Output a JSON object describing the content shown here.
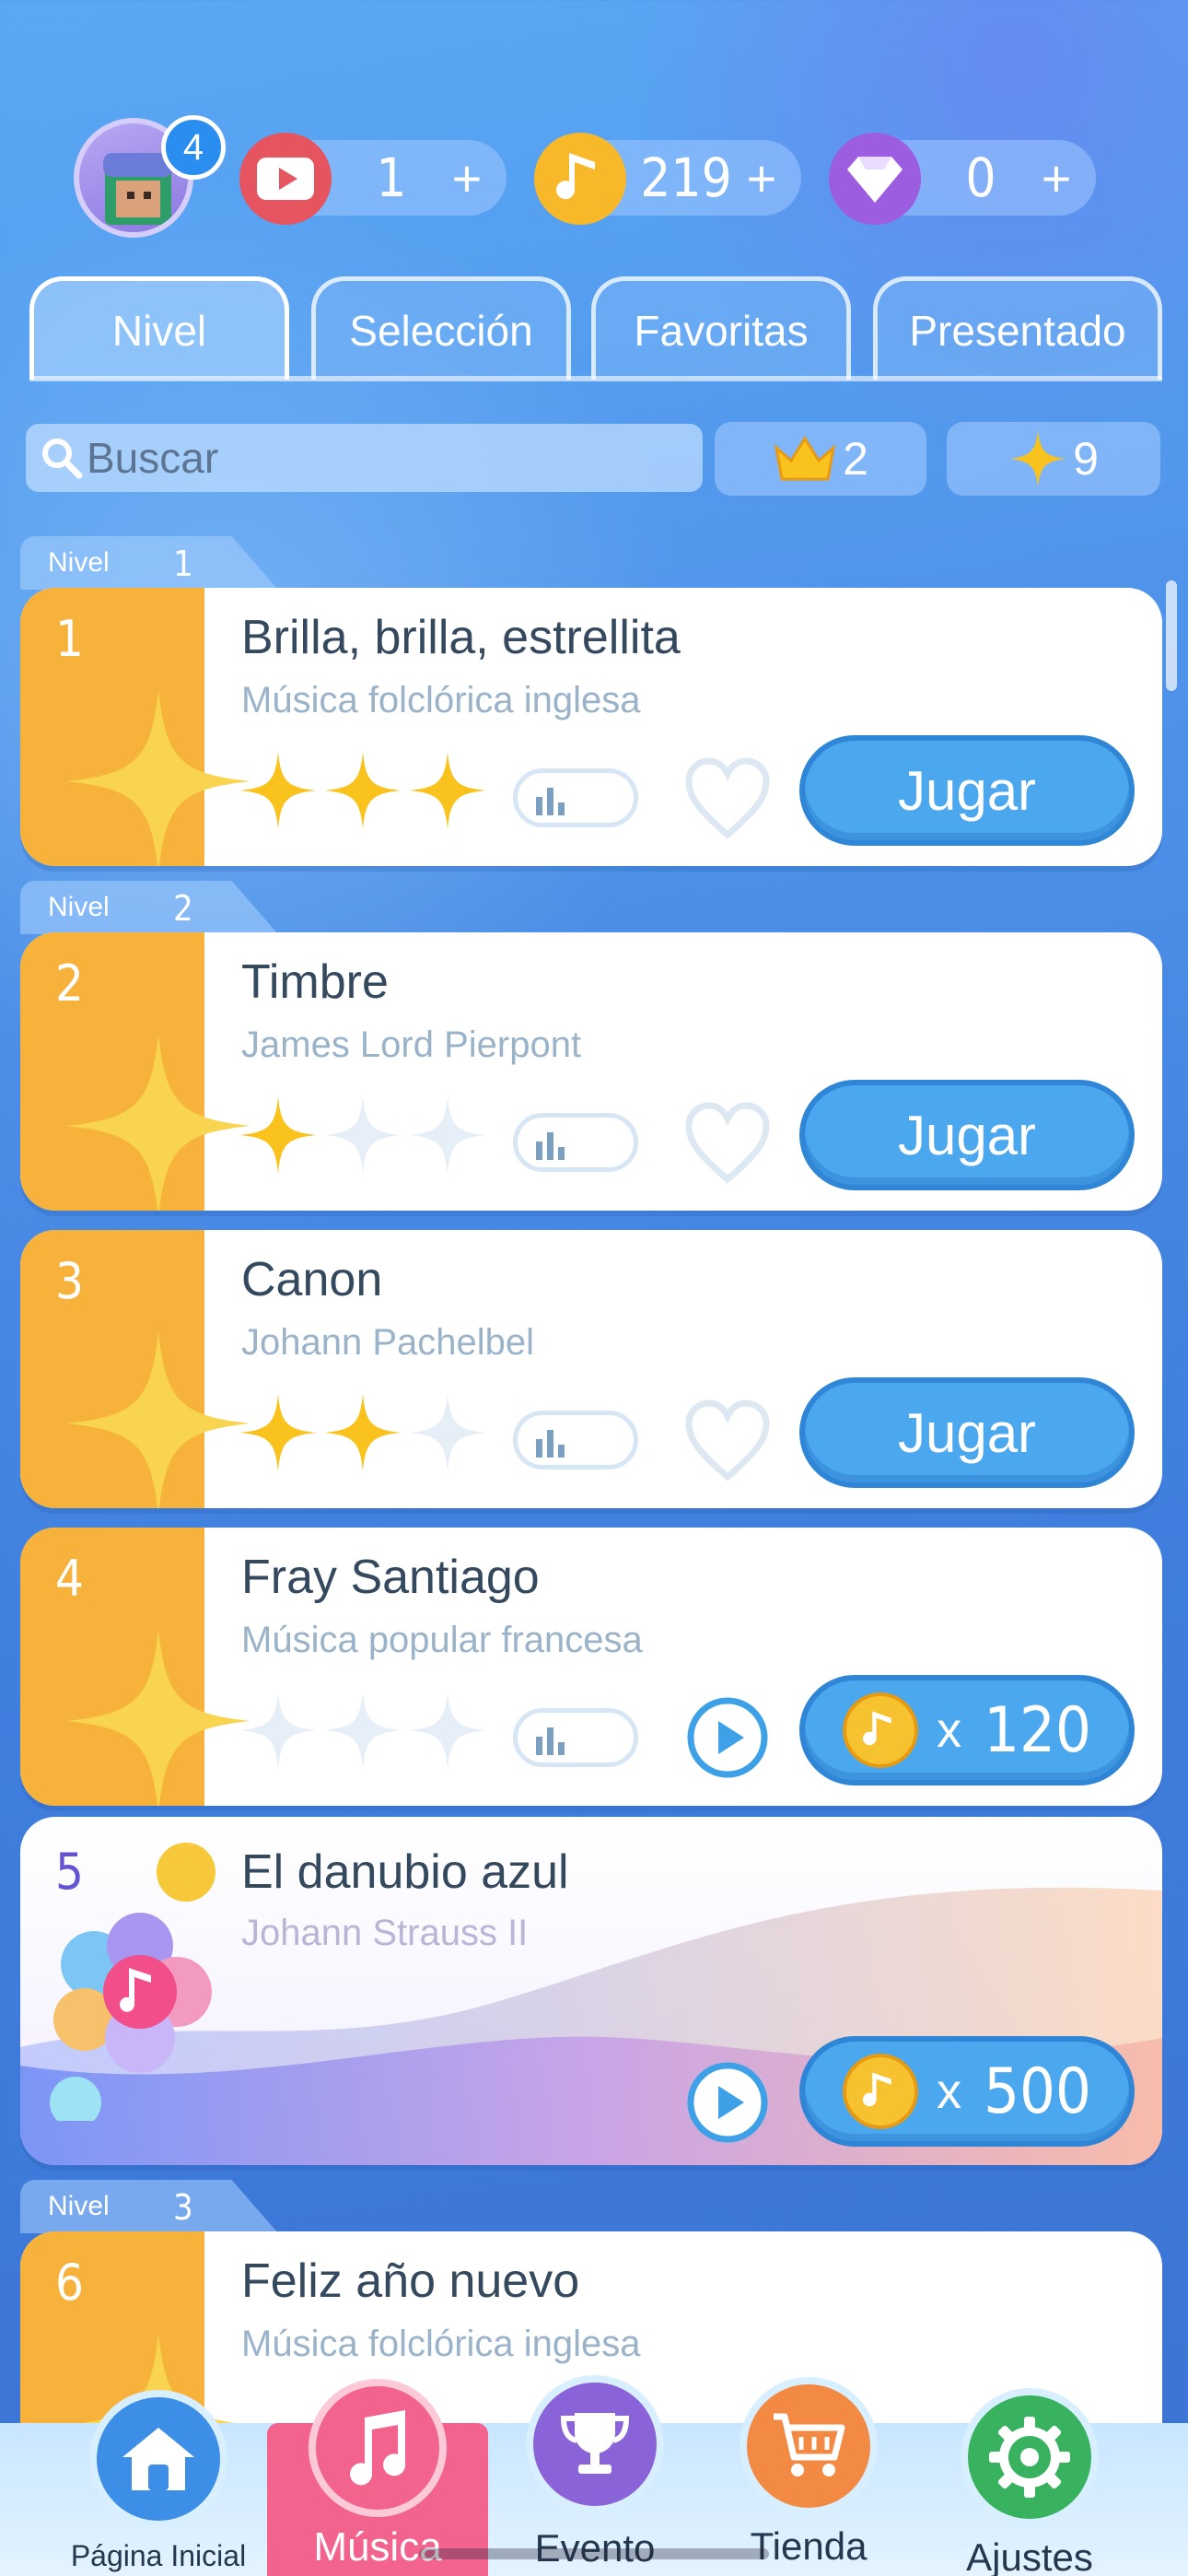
{
  "header": {
    "avatar_badge": "4",
    "currencies": [
      {
        "name": "tickets",
        "value": "1",
        "plus": "+"
      },
      {
        "name": "notes",
        "value": "219",
        "plus": "+"
      },
      {
        "name": "diamonds",
        "value": "0",
        "plus": "+"
      }
    ]
  },
  "tabs": [
    {
      "label": "Nivel",
      "active": true
    },
    {
      "label": "Selección",
      "active": false
    },
    {
      "label": "Favoritas",
      "active": false
    },
    {
      "label": "Presentado",
      "active": false
    }
  ],
  "search": {
    "placeholder": "Buscar"
  },
  "stats": {
    "crowns": "2",
    "stars": "9"
  },
  "levels": [
    {
      "label": "Nivel",
      "number": "1"
    },
    {
      "label": "Nivel",
      "number": "2"
    },
    {
      "label": "Nivel",
      "number": "3"
    }
  ],
  "songs": [
    {
      "num": "1",
      "title": "Brilla, brilla, estrellita",
      "artist": "Música folclórica inglesa",
      "stars": 3,
      "action": "Jugar"
    },
    {
      "num": "2",
      "title": "Timbre",
      "artist": "James Lord Pierpont",
      "stars": 1,
      "action": "Jugar"
    },
    {
      "num": "3",
      "title": "Canon",
      "artist": "Johann Pachelbel",
      "stars": 2,
      "action": "Jugar"
    },
    {
      "num": "4",
      "title": "Fray Santiago",
      "artist": "Música popular francesa",
      "stars": 0,
      "price_x": "x",
      "price": "120"
    },
    {
      "num": "5",
      "title": "El danubio azul",
      "artist": "Johann Strauss II",
      "price_x": "x",
      "price": "500"
    },
    {
      "num": "6",
      "title": "Feliz año nuevo",
      "artist": "Música folclórica inglesa"
    }
  ],
  "nav": [
    {
      "label": "Página Inicial",
      "icon": "home-icon"
    },
    {
      "label": "Música",
      "icon": "music-note-icon",
      "active": true
    },
    {
      "label": "Evento",
      "icon": "trophy-icon"
    },
    {
      "label": "Tienda",
      "icon": "cart-icon"
    },
    {
      "label": "Ajustes",
      "icon": "gear-icon"
    }
  ],
  "colors": {
    "card_left": "#f6b23a",
    "button": "#4ba7ee",
    "star_gold": "#f9c21c",
    "nav_active": "#f2638e"
  }
}
